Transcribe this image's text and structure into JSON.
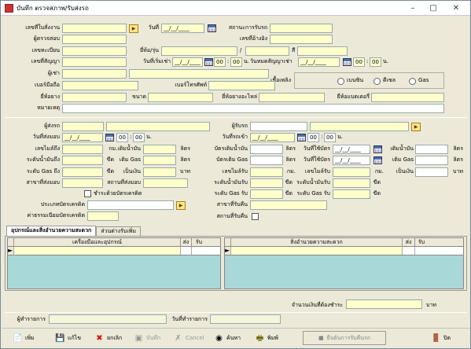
{
  "window": {
    "title": "บันทึก ตรวจสภาพ/รับส่งรถ"
  },
  "s1": {
    "job_no": "เลขที่ใบสั่งงาน",
    "date": "วันที่",
    "date_val": "__/__/____",
    "status": "สถานะการรับรถ",
    "inspector": "ผู้ตรวจสอบ",
    "ref_no": "เลขที่อ้างอิง",
    "reg_no": "เลขทะเบียน",
    "brand_model": "ยี่ห้อ/รุ่น",
    "slash": "/",
    "color": "สี",
    "contract_no": "เลขที่สัญญา",
    "rent_start": "วันที่เริ่มเช่า",
    "rent_end": "วันหมดสัญญาเช่า",
    "date_ph": "__/__/____",
    "hh": "00",
    "mm": "00",
    "n": "น.",
    "renter": "ผู้เช่า",
    "fuel": "เชื้อเพลิง",
    "fuel_opts": [
      "เบนซิน",
      "ดีเซล",
      "Gas"
    ],
    "mobile": "เบอร์มือถือ",
    "phone": "เบอร์โทรศัพท์",
    "tire_brand": "ยี่ห้อยาง",
    "size": "ขนาด",
    "spare_brand": "ยี่ห้อยางอะไหล่",
    "battery_brand": "ยี่ห้อแบตเตอรี่",
    "note": "หมายเหตุ"
  },
  "s2": {
    "sender": "ผู้ส่งรถ",
    "receiver": "ผู้รับรถ",
    "send_date": "วันที่ส่งมอบ",
    "recv_date": "วันที่รถเข้า",
    "date_ph": "__/__/____",
    "hh": "00",
    "mm": "00",
    "n": "น.",
    "mile_out": "เลขไมล์ถึง",
    "km_fuel": "กม.เติมน้ำมัน",
    "liter": "ลิตร",
    "fuel_card": "บัตรเติมน้ำมัน",
    "used_date": "วันที่ใช้บัตร",
    "fuel_refill": "เติมน้ำมัน",
    "fuel_level_out": "ระดับน้ำมันถึง",
    "pct": "ขีด",
    "gas_fill": "เติม Gas",
    "gas_card": "บัตรเติม Gas",
    "gas_fill2": "เติม Gas",
    "gas_level_out": "ระดับ Gas ถึง",
    "cash": "เป็นเงิน",
    "baht": "บาท",
    "mile_in": "เลขไมล์รับ",
    "km": "กม.",
    "mile_in2": "เลขไมล์รับ",
    "km2": "กม.",
    "cash2": "เป็นเงิน",
    "baht2": "บาท",
    "branch_out": "สาขาที่ส่งมอบ",
    "place_out": "สถานที่ส่งมอบ",
    "fuel_in": "ระดับน้ำมันรับ",
    "pct2": "ขีด",
    "fuel_in2": "ระดับน้ำมันรับ",
    "pct3": "ขีด",
    "credit_chk": "ชำระด้วยบัตรเครดิต",
    "gas_in": "ระดับ Gas รับ",
    "pct4": "ขีด",
    "gas_in2": "ระดับ Gas รับ",
    "pct5": "ขีด",
    "card_type": "ประเภทบัตรเครดิต",
    "branch_in": "สาขาที่รับคืน",
    "fee": "ค่าธรรมเนียมบัตรเครดิต",
    "place_in": "สถานที่รับคืน"
  },
  "tabs": [
    "อุปกรณ์และสิ่งอำนวยความสะดวก",
    "ส่วนต่างรับเพิ่ม"
  ],
  "grid_left": {
    "headers": [
      "เครื่องมือและอุปกรณ์",
      "ส่ง",
      "รับ"
    ]
  },
  "grid_right": {
    "headers": [
      "สิ่งอำนวยความสะดวก",
      "ส่ง",
      "รับ"
    ]
  },
  "footer": {
    "amount": "จำนวนเงินที่ต้องชำระ",
    "baht": "บาท",
    "recorder": "ผู้ทำรายการ",
    "record_date": "วันที่ทำรายการ"
  },
  "toolbar": {
    "add": "เพิ่ม",
    "edit": "แก้ไข",
    "cancel_rec": "ยกเลิก",
    "save": "บันทึก",
    "cancel": "Cancel",
    "search": "ค้นหา",
    "print": "พิมพ์",
    "confirm": "ยืนยันการรับคืนรถ",
    "close": "ปิด"
  }
}
